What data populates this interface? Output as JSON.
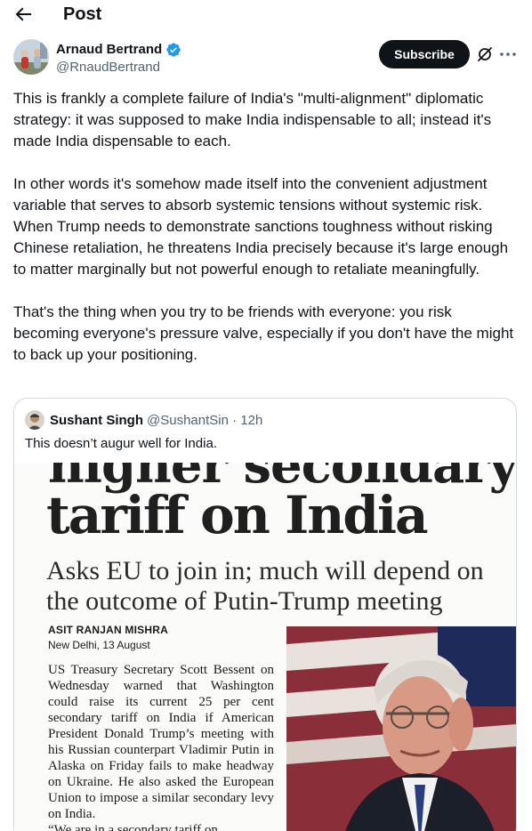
{
  "header": {
    "title": "Post",
    "back_icon": "arrow-left-icon"
  },
  "author": {
    "name": "Arnaud Bertrand",
    "handle": "@RnaudBertrand",
    "verified": true,
    "verified_color": "#1d9bf0",
    "subscribe_label": "Subscribe",
    "icons": [
      "grok-icon",
      "more-icon"
    ]
  },
  "tweet": {
    "paragraphs": [
      "This is frankly a complete failure of India's \"multi-alignment\" diplomatic strategy: it was supposed to make India indispensable to all; instead it's made India dispensable to each.",
      "In other words it's somehow made itself into the convenient adjustment variable that serves to absorb systemic tensions without systemic risk. When Trump needs to demonstrate sanctions toughness without risking Chinese retaliation, he threatens India precisely because it's large enough to matter marginally but not powerful enough to retaliate meaningfully.",
      "That's the thing when you try to be friends with everyone: you risk becoming everyone's pressure valve, especially if you don't have the might to back up your positioning."
    ]
  },
  "quoted_post": {
    "name": "Sushant Singh",
    "handle": "@SushantSin",
    "separator": "·",
    "time": "12h",
    "text": "This doesn’t augur well for India.",
    "media": {
      "cut_headline": "higher secondary",
      "headline": "tariff on India",
      "deck": "Asks EU to join in; much will depend on the outcome of Putin-Trump meeting",
      "byline": "ASIT RANJAN MISHRA",
      "dateline": "New Delhi, 13 August",
      "body": "US Treasury Secretary Scott Bessent on Wednesday warned that Washington could raise its current 25 per cent secondary tariff on India if American President Donald Trump’s meeting with his Russian counterpart Vladimir Putin in Alaska on Friday fails to make headway on Ukraine. He also asked the European Union to impose a similar secondary levy on India.",
      "body_cut": "“We are in a secondary tariff on"
    }
  },
  "colors": {
    "text": "#0f1419",
    "secondary": "#536471",
    "border": "#cfd9de",
    "accent": "#1d9bf0"
  }
}
